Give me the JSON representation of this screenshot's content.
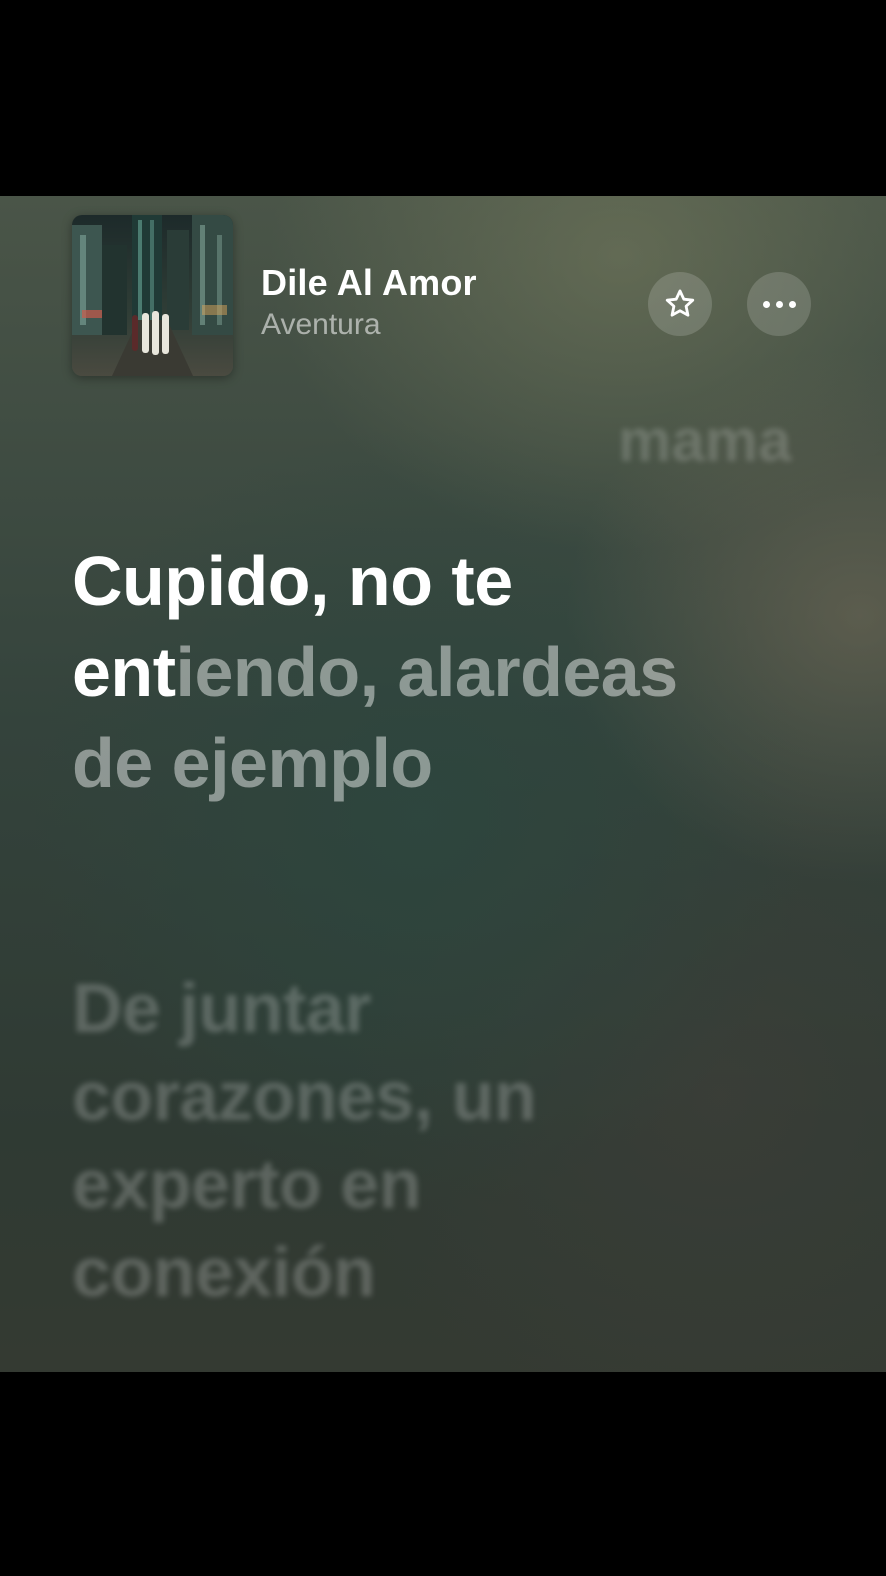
{
  "now_playing": {
    "title": "Dile Al Amor",
    "artist": "Aventura"
  },
  "buttons": {
    "favorite_icon": "star-icon",
    "more_icon": "ellipsis-icon"
  },
  "lyrics": {
    "previous_line": "mama",
    "current_line_sung": "Cupido, no te ent",
    "current_line_unsung": "iendo, alardeas de ejemplo",
    "next_line": "De juntar corazones, un experto en conexión"
  },
  "colors": {
    "background_top": "#4a5548",
    "background_mid": "#34433c",
    "background_bottom": "#343a32",
    "text_active": "#ffffff"
  }
}
